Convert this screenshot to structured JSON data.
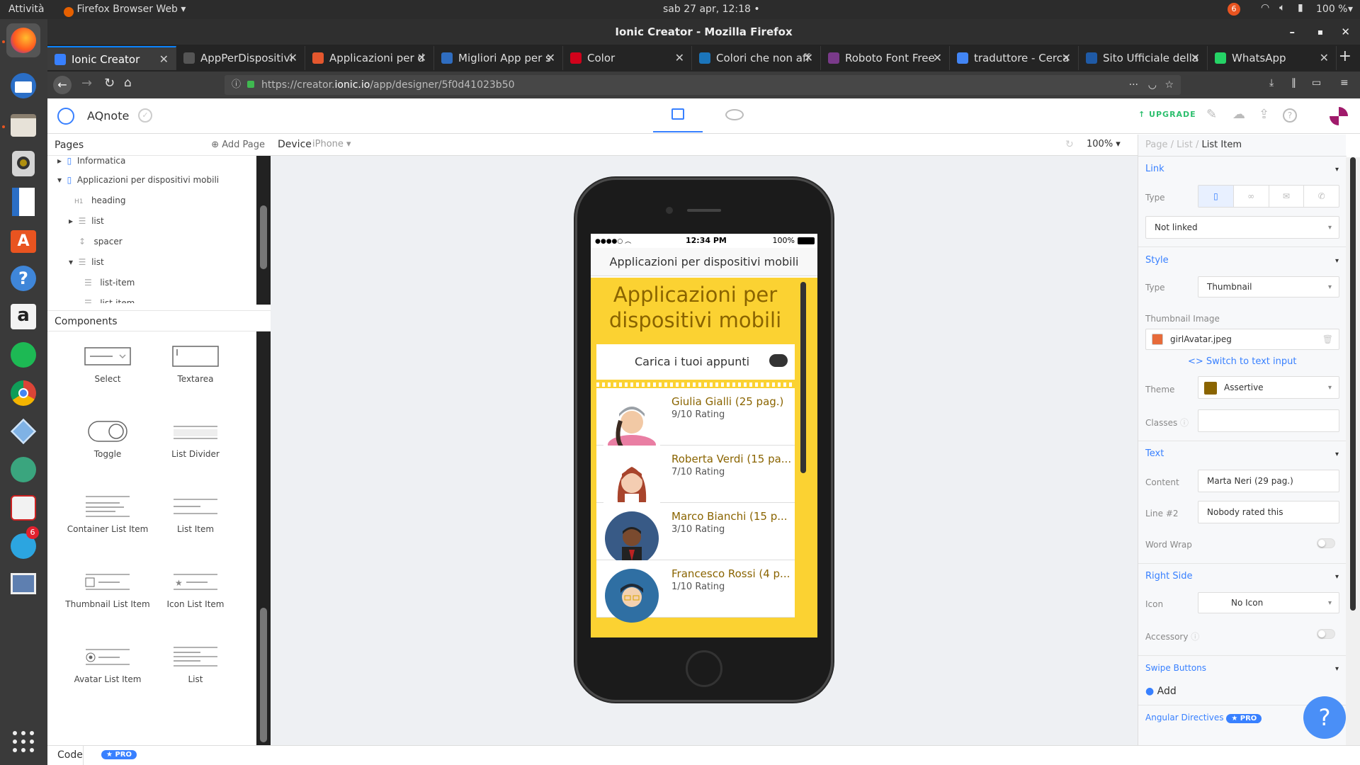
{
  "os": {
    "activities": "Attività",
    "app_menu": "Firefox Browser Web",
    "clock": "sab 27 apr, 12:18",
    "notifications_count": "6",
    "battery": "100 %"
  },
  "dock": {
    "telegram_badge": "6"
  },
  "window": {
    "title": "Ionic Creator - Mozilla Firefox"
  },
  "tabs": [
    {
      "label": "Ionic Creator",
      "color": "#3880ff"
    },
    {
      "label": "AppPerDispositivi",
      "color": "#555555"
    },
    {
      "label": "Applicazioni per d",
      "color": "#e4572e"
    },
    {
      "label": "Migliori App per s",
      "color": "#2f6dc0"
    },
    {
      "label": "Color",
      "color": "#d0021b"
    },
    {
      "label": "Colori che non aff",
      "color": "#1b75bb"
    },
    {
      "label": "Roboto Font Free",
      "color": "#7a3a8a"
    },
    {
      "label": "traduttore - Cerca",
      "color": "#4285f4"
    },
    {
      "label": "Sito Ufficiale della",
      "color": "#1f5aa6"
    },
    {
      "label": "WhatsApp",
      "color": "#25d366"
    }
  ],
  "url": {
    "prefix": "https://creator.",
    "domain": "ionic.io",
    "path": "/app/designer/5f0d41023b50"
  },
  "app": {
    "project_name": "AQnote",
    "upgrade": "UPGRADE"
  },
  "pages_panel": {
    "title": "Pages",
    "add_page": "Add Page",
    "tree": [
      "Informatica",
      "Applicazioni per dispositivi mobili",
      "heading",
      "list",
      "spacer",
      "list",
      "list-item",
      "list-item"
    ],
    "heading_tag": "H1"
  },
  "components_panel": {
    "title": "Components",
    "items": [
      "Select",
      "Textarea",
      "Toggle",
      "List Divider",
      "Container List Item",
      "List Item",
      "Thumbnail List Item",
      "Icon List Item",
      "Avatar List Item",
      "List"
    ]
  },
  "device_bar": {
    "label": "Device",
    "device": "iPhone",
    "zoom": "100%"
  },
  "phone": {
    "time": "12:34 PM",
    "battery": "100%",
    "nav_title": "Applicazioni per dispositivi mobili",
    "heading": "Applicazioni per dispositivi mobili",
    "upload_label": "Carica i tuoi appunti",
    "items": [
      {
        "name": "Giulia Gialli (25 pag.)",
        "rating": "9/10 Rating"
      },
      {
        "name": "Roberta Verdi (15 pa...",
        "rating": "7/10 Rating"
      },
      {
        "name": "Marco Bianchi (15 p...",
        "rating": "3/10 Rating"
      },
      {
        "name": "Francesco Rossi (4 p...",
        "rating": "1/10 Rating"
      }
    ],
    "theme_color": "#fbd232"
  },
  "props": {
    "breadcrumb": [
      "Page",
      "List",
      "List Item"
    ],
    "link": {
      "title": "Link",
      "type_label": "Type",
      "link_value": "Not linked"
    },
    "style": {
      "title": "Style",
      "type_label": "Type",
      "type_value": "Thumbnail",
      "thumb_label": "Thumbnail Image",
      "thumb_value": "girlAvatar.jpeg",
      "switch_text": "Switch to text input",
      "theme_label": "Theme",
      "theme_value": "Assertive",
      "theme_color": "#8a6400",
      "classes_label": "Classes"
    },
    "text": {
      "title": "Text",
      "content_label": "Content",
      "content_value": "Marta Neri (29 pag.)",
      "line2_label": "Line #2",
      "line2_value": "Nobody rated this",
      "wrap_label": "Word Wrap"
    },
    "right_side": {
      "title": "Right Side",
      "icon_label": "Icon",
      "icon_value": "No Icon",
      "accessory_label": "Accessory"
    },
    "swipe": {
      "title": "Swipe Buttons",
      "add": "Add"
    },
    "angular": {
      "title": "Angular Directives",
      "pro": "★ PRO"
    }
  },
  "bottom": {
    "code": "Code",
    "pro": "★ PRO"
  }
}
